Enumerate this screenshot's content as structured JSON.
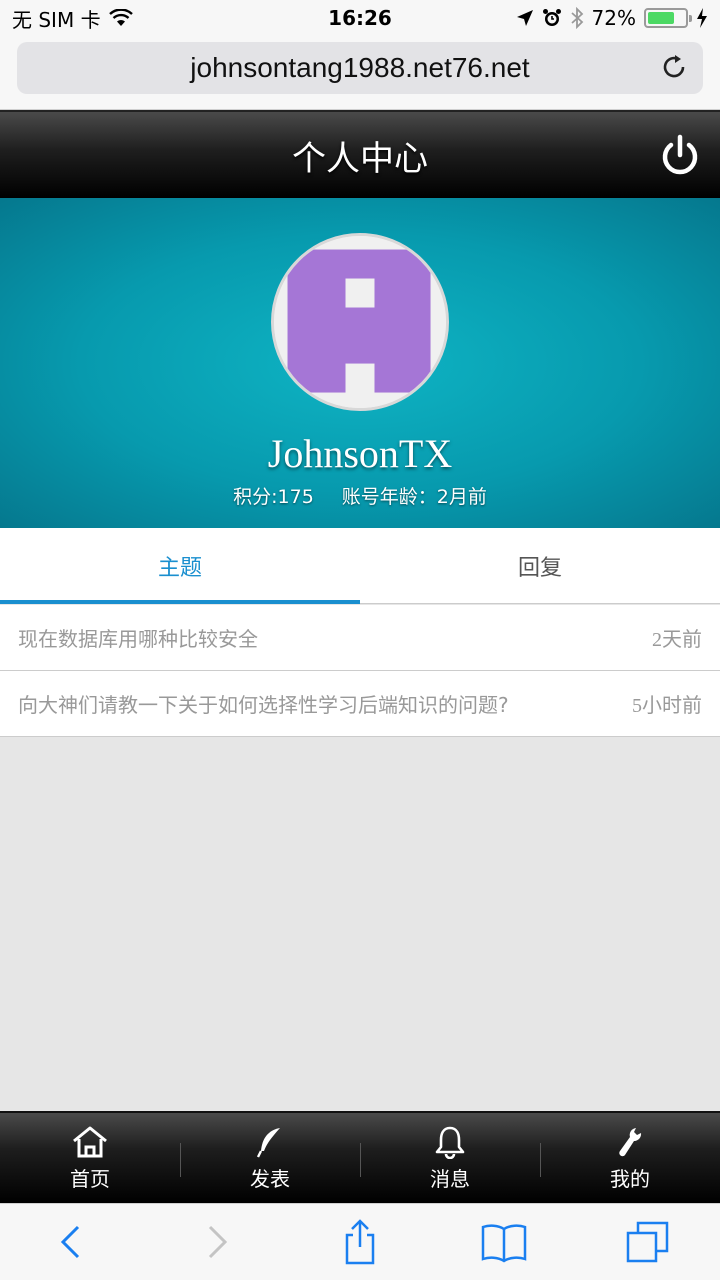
{
  "status_bar": {
    "carrier": "无 SIM 卡",
    "time": "16:26",
    "battery": "72%",
    "battery_level": 0.72,
    "icons": [
      "wifi-icon",
      "location-icon",
      "alarm-icon",
      "bluetooth-icon",
      "charging-icon"
    ]
  },
  "browser": {
    "url": "johnsontang1988.net76.net"
  },
  "header": {
    "title": "个人中心"
  },
  "profile": {
    "username": "JohnsonTX",
    "points": "积分:175",
    "account_age": "账号年龄：2月前",
    "avatar_color": "#a576d6"
  },
  "tabs": [
    {
      "label": "主题",
      "active": true
    },
    {
      "label": "回复",
      "active": false
    }
  ],
  "topics": [
    {
      "title": "现在数据库用哪种比较安全",
      "time": "2天前"
    },
    {
      "title": "向大神们请教一下关于如何选择性学习后端知识的问题?",
      "time": "5小时前"
    }
  ],
  "bottom_nav": [
    {
      "label": "首页",
      "icon": "home-icon"
    },
    {
      "label": "发表",
      "icon": "feather-icon"
    },
    {
      "label": "消息",
      "icon": "bell-icon"
    },
    {
      "label": "我的",
      "icon": "wrench-icon"
    }
  ],
  "colors": {
    "accent": "#1a8fcf",
    "banner": "#079aae"
  }
}
